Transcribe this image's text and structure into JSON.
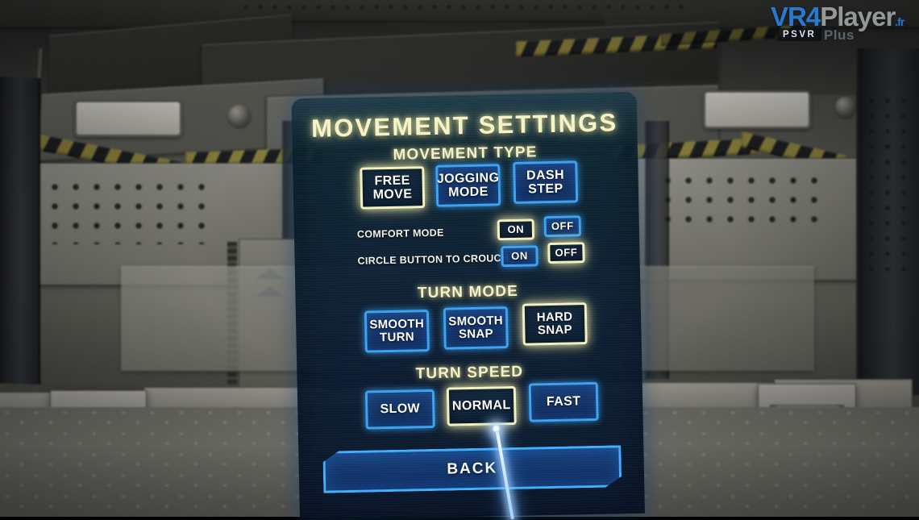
{
  "watermark": {
    "vr": "VR",
    "four": "4",
    "player": "Player",
    "tld": ".fr",
    "badge": "PSVR",
    "sub": "Plus"
  },
  "menu": {
    "title": "MOVEMENT SETTINGS",
    "sections": [
      {
        "id": "movement-type",
        "heading": "MOVEMENT TYPE",
        "options": [
          {
            "line1": "FREE",
            "line2": "MOVE",
            "selected": true
          },
          {
            "line1": "JOGGING",
            "line2": "MODE",
            "selected": false
          },
          {
            "line1": "DASH",
            "line2": "STEP",
            "selected": false
          }
        ]
      },
      {
        "id": "turn-mode",
        "heading": "TURN MODE",
        "options": [
          {
            "line1": "SMOOTH",
            "line2": "TURN",
            "selected": false
          },
          {
            "line1": "SMOOTH",
            "line2": "SNAP",
            "selected": false
          },
          {
            "line1": "HARD",
            "line2": "SNAP",
            "selected": true
          }
        ]
      },
      {
        "id": "turn-speed",
        "heading": "TURN SPEED",
        "options": [
          {
            "line1": "SLOW",
            "line2": "",
            "selected": false
          },
          {
            "line1": "NORMAL",
            "line2": "",
            "selected": true
          },
          {
            "line1": "FAST",
            "line2": "",
            "selected": false
          }
        ]
      }
    ],
    "toggles": [
      {
        "id": "comfort-mode",
        "label": "COMFORT MODE",
        "on_label": "ON",
        "off_label": "OFF",
        "value": "ON"
      },
      {
        "id": "circle-button-to-crouch",
        "label": "CIRCLE BUTTON TO CROUCH",
        "on_label": "ON",
        "off_label": "OFF",
        "value": "OFF"
      }
    ],
    "back_label": "BACK"
  },
  "colors": {
    "accent_blue": "#3aa2f0",
    "selected_yellow": "#f3f1bd",
    "panel_bg": "#0a2034",
    "title_text": "#f4f3c8",
    "hazard_yellow": "#d8c64a",
    "led_blue": "#54b8ff"
  },
  "pointer": {
    "type": "vr-laser-pointer",
    "target": "NORMAL"
  }
}
